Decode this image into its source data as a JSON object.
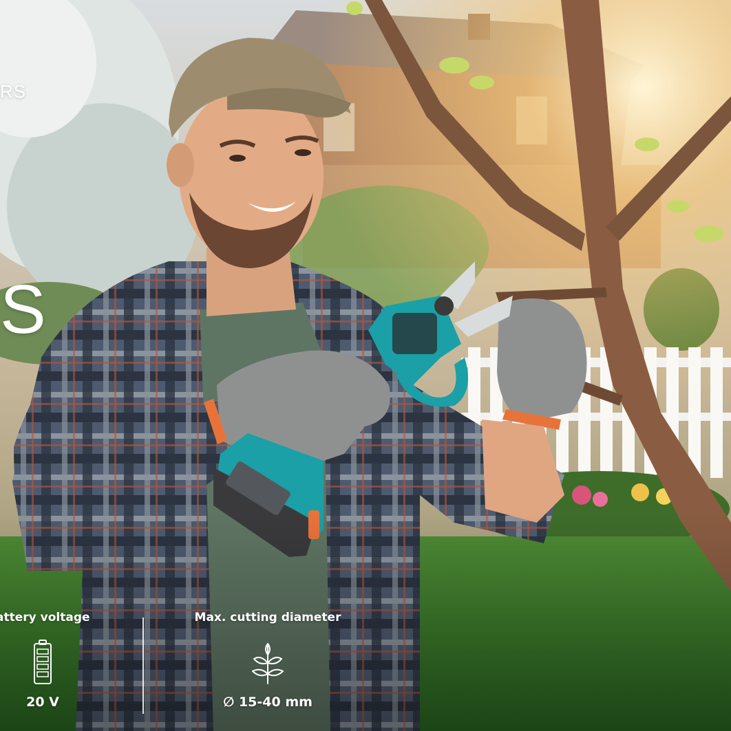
{
  "hero": {
    "eyebrow": "RS",
    "headline": "S",
    "image_subject": "gardener-pruning-tree-icon"
  },
  "specs": [
    {
      "label": "attery voltage",
      "value": "20 V",
      "icon": "battery-icon"
    },
    {
      "label": "Max. cutting diameter",
      "value": "∅  15-40 mm",
      "icon": "leaf-sprig-icon"
    }
  ],
  "colors": {
    "tool_teal": "#1aa0a6",
    "grass": "#3f8a2e",
    "sky": "#e6dfcf"
  }
}
